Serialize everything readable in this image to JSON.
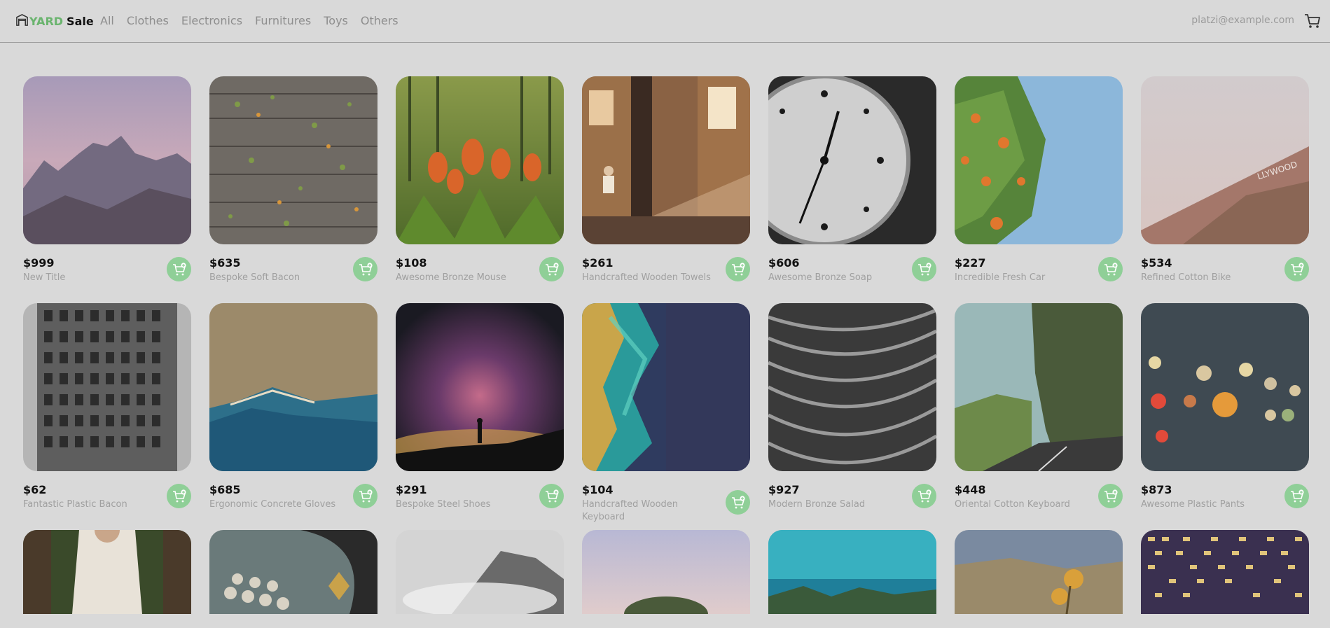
{
  "nav": {
    "logo_yard": "YARD",
    "logo_sale": "Sale",
    "links": [
      "All",
      "Clothes",
      "Electronics",
      "Furnitures",
      "Toys",
      "Others"
    ],
    "email": "platzi@example.com",
    "cart_icon": "shopping-cart-icon"
  },
  "products": [
    {
      "price": "$999",
      "title": "New Title"
    },
    {
      "price": "$635",
      "title": "Bespoke Soft Bacon"
    },
    {
      "price": "$108",
      "title": "Awesome Bronze Mouse"
    },
    {
      "price": "$261",
      "title": "Handcrafted Wooden Towels"
    },
    {
      "price": "$606",
      "title": "Awesome Bronze Soap"
    },
    {
      "price": "$227",
      "title": "Incredible Fresh Car"
    },
    {
      "price": "$534",
      "title": "Refined Cotton Bike"
    },
    {
      "price": "$62",
      "title": "Fantastic Plastic Bacon"
    },
    {
      "price": "$685",
      "title": "Ergonomic Concrete Gloves"
    },
    {
      "price": "$291",
      "title": "Bespoke Steel Shoes"
    },
    {
      "price": "$104",
      "title": "Handcrafted Wooden Keyboard"
    },
    {
      "price": "$927",
      "title": "Modern Bronze Salad"
    },
    {
      "price": "$448",
      "title": "Oriental Cotton Keyboard"
    },
    {
      "price": "$873",
      "title": "Awesome Plastic Pants"
    }
  ],
  "colors": {
    "accent": "#6ab46e",
    "button": "#8fcf97",
    "background": "#d9d9d9"
  }
}
